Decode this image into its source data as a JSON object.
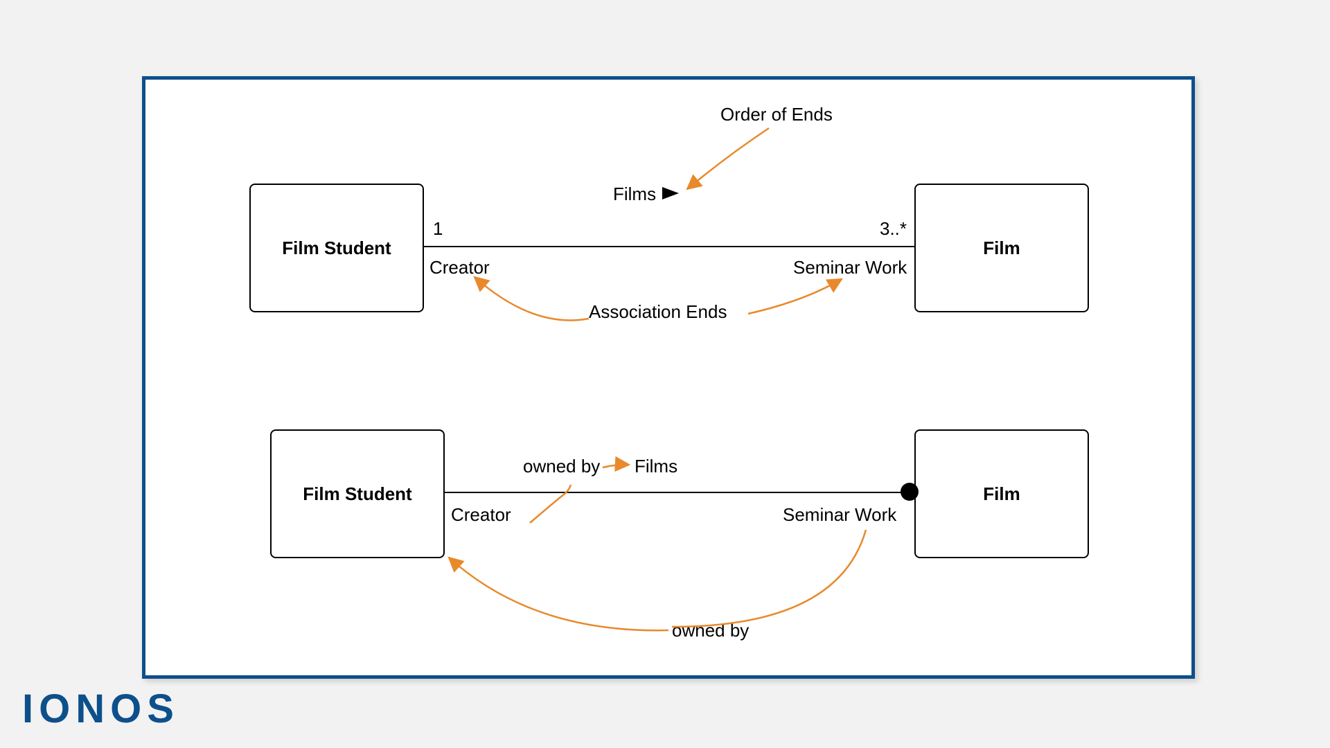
{
  "brand": "IONOS",
  "diagram1": {
    "left_class": "Film Student",
    "right_class": "Film",
    "assoc_name": "Films",
    "left_mult": "1",
    "right_mult": "3..*",
    "left_role": "Creator",
    "right_role": "Seminar Work",
    "note_top": "Order of Ends",
    "note_mid": "Association Ends"
  },
  "diagram2": {
    "left_class": "Film Student",
    "right_class": "Film",
    "assoc_name": "Films",
    "left_role": "Creator",
    "right_role": "Seminar Work",
    "owned_by_top": "owned by",
    "owned_by_bottom": "owned by"
  }
}
